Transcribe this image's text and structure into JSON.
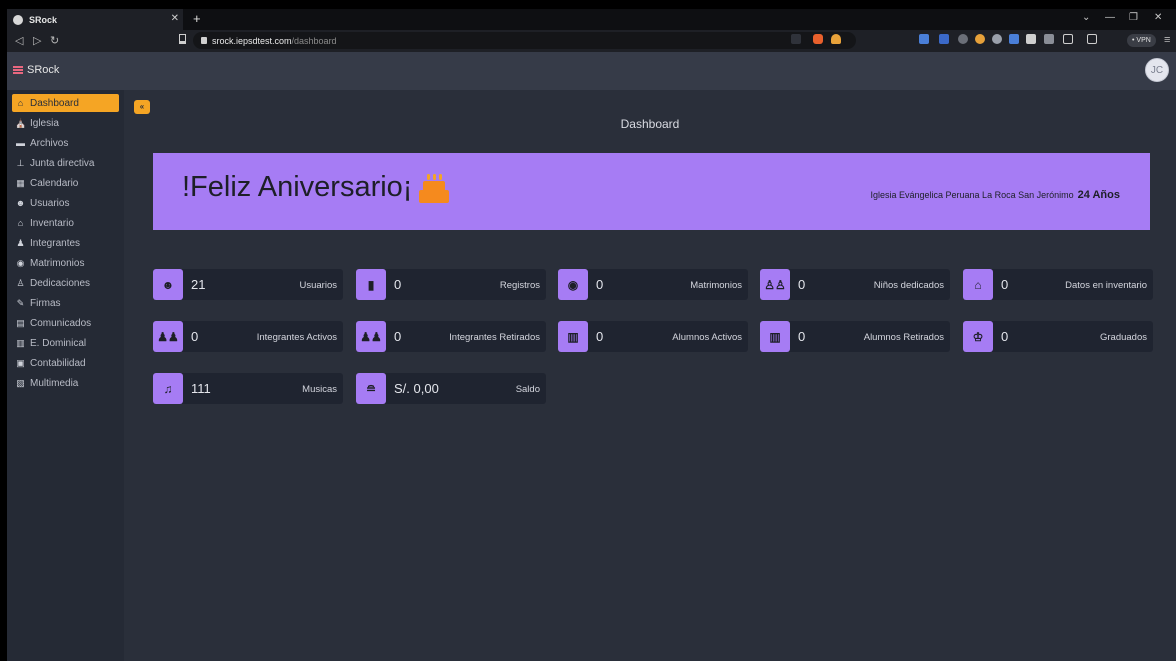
{
  "browser": {
    "tab_title": "SRock",
    "url_host": "srock.iepsdtest.com",
    "url_path": "/dashboard",
    "vpn_label": "• VPN"
  },
  "app": {
    "brand": "SRock",
    "avatar_initials": "JC"
  },
  "sidebar": {
    "items": [
      {
        "label": "Dashboard",
        "icon": "home-icon"
      },
      {
        "label": "Iglesia",
        "icon": "church-icon"
      },
      {
        "label": "Archivos",
        "icon": "folder-icon"
      },
      {
        "label": "Junta directiva",
        "icon": "sitemap-icon"
      },
      {
        "label": "Calendario",
        "icon": "calendar-icon"
      },
      {
        "label": "Usuarios",
        "icon": "users-icon"
      },
      {
        "label": "Inventario",
        "icon": "warehouse-icon"
      },
      {
        "label": "Integrantes",
        "icon": "people-group-icon"
      },
      {
        "label": "Matrimonios",
        "icon": "ring-icon"
      },
      {
        "label": "Dedicaciones",
        "icon": "children-icon"
      },
      {
        "label": "Firmas",
        "icon": "signature-icon"
      },
      {
        "label": "Comunicados",
        "icon": "newspaper-icon"
      },
      {
        "label": "E. Dominical",
        "icon": "school-icon"
      },
      {
        "label": "Contabilidad",
        "icon": "cash-register-icon"
      },
      {
        "label": "Multimedia",
        "icon": "photo-film-icon"
      }
    ]
  },
  "main": {
    "title": "Dashboard",
    "banner": {
      "headline": "!Feliz Aniversario¡",
      "church": "Iglesia Evángelica Peruana La Roca San Jerónimo",
      "years": "24 Años"
    },
    "cards": [
      {
        "value": "21",
        "label": "Usuarios",
        "icon": "users-icon"
      },
      {
        "value": "0",
        "label": "Registros",
        "icon": "file-icon"
      },
      {
        "value": "0",
        "label": "Matrimonios",
        "icon": "ring-icon"
      },
      {
        "value": "0",
        "label": "Niños dedicados",
        "icon": "children-icon"
      },
      {
        "value": "0",
        "label": "Datos en inventario",
        "icon": "warehouse-icon"
      },
      {
        "value": "0",
        "label": "Integrantes Activos",
        "icon": "people-group-icon"
      },
      {
        "value": "0",
        "label": "Integrantes Retirados",
        "icon": "people-group-icon"
      },
      {
        "value": "0",
        "label": "Alumnos Activos",
        "icon": "school-icon"
      },
      {
        "value": "0",
        "label": "Alumnos Retirados",
        "icon": "school-icon"
      },
      {
        "value": "0",
        "label": "Graduados",
        "icon": "graduate-icon"
      },
      {
        "value": "111",
        "label": "Musicas",
        "icon": "music-icon"
      },
      {
        "value": "S/. 0,00",
        "label": "Saldo",
        "icon": "coins-icon"
      }
    ]
  },
  "colors": {
    "accent": "#f5a524",
    "purple": "#a67cf4",
    "background": "#2a2f3a"
  }
}
